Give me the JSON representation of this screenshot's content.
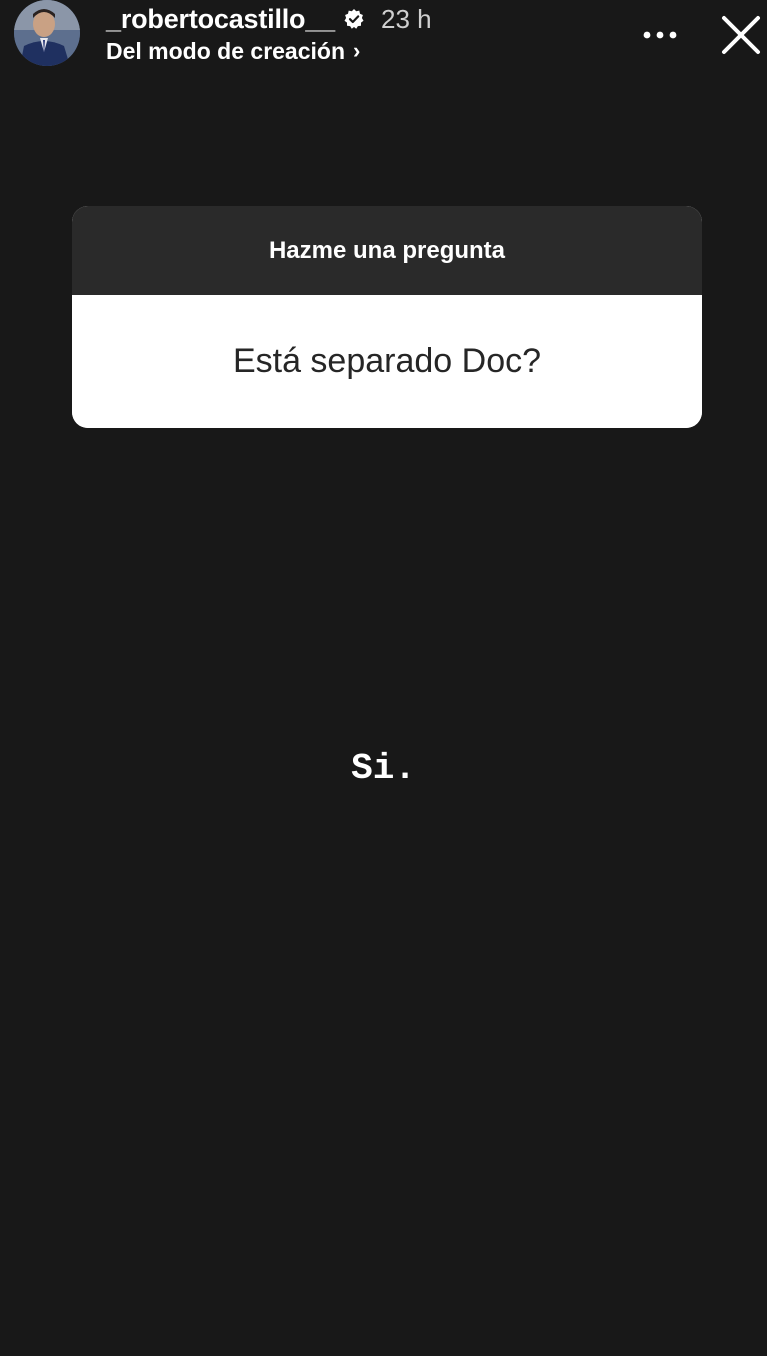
{
  "header": {
    "username": "_robertocastillo__",
    "verified_icon": "verified-badge-icon",
    "time": "23 h",
    "subtitle": "Del modo de creación",
    "subtitle_chevron": "›",
    "more_icon": "more-options-icon",
    "close_icon": "close-icon"
  },
  "question_sticker": {
    "title": "Hazme una pregunta",
    "question": "Está separado Doc?"
  },
  "answer": {
    "text": "Si."
  },
  "colors": {
    "background": "#181818",
    "card_header": "#2a2a2a",
    "card_body": "#ffffff",
    "text_light": "#ffffff",
    "text_dark": "#262626"
  }
}
